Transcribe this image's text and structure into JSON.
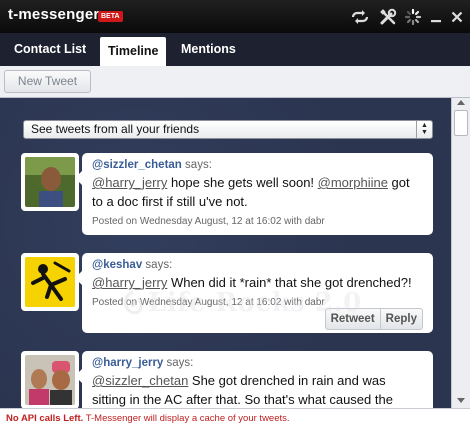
{
  "app": {
    "name": "t-messenger",
    "badge": "BETA"
  },
  "titlebar_icons": [
    "refresh-icon",
    "tools-icon",
    "loading-spinner-icon",
    "minimize-icon",
    "close-icon"
  ],
  "tabs": [
    {
      "label": "Contact List",
      "active": false
    },
    {
      "label": "Timeline",
      "active": true
    },
    {
      "label": "Mentions",
      "active": false
    }
  ],
  "toolbar": {
    "new_tweet_label": "New Tweet"
  },
  "filter": {
    "selected": "See tweets from all your friends"
  },
  "tweets": [
    {
      "username": "@sizzler_chetan",
      "says": "says:",
      "mention1": "@harry_jerry",
      "text1": " hope she gets well soon! ",
      "mention2": "@morphiine",
      "text2": " got to a doc first if still u've not.",
      "posted": "Posted on Wednesday August, 12 at 16:02 with dabr"
    },
    {
      "username": "@keshav",
      "says": "says:",
      "mention1": "@harry_jerry",
      "text1": " When did it *rain* that she got drenched?!",
      "posted": "Posted on Wednesday August, 12 at 16:02 with dabr",
      "retweet_label": "Retweet",
      "reply_label": "Reply"
    },
    {
      "username": "@harry_jerry",
      "says": "says:",
      "mention1": "@sizzler_chetan",
      "text1": " She got drenched in rain and was sitting in the AC after that. So that's what caused the"
    }
  ],
  "watermark": "Life Rocks 2.0",
  "status": {
    "strong": "No API calls Left.",
    "message": " T-Messenger will display a cache of your tweets."
  },
  "colors": {
    "background": "#2b3550",
    "username": "#3a5d96",
    "status_text": "#c02020",
    "beta_badge": "#d01818"
  }
}
